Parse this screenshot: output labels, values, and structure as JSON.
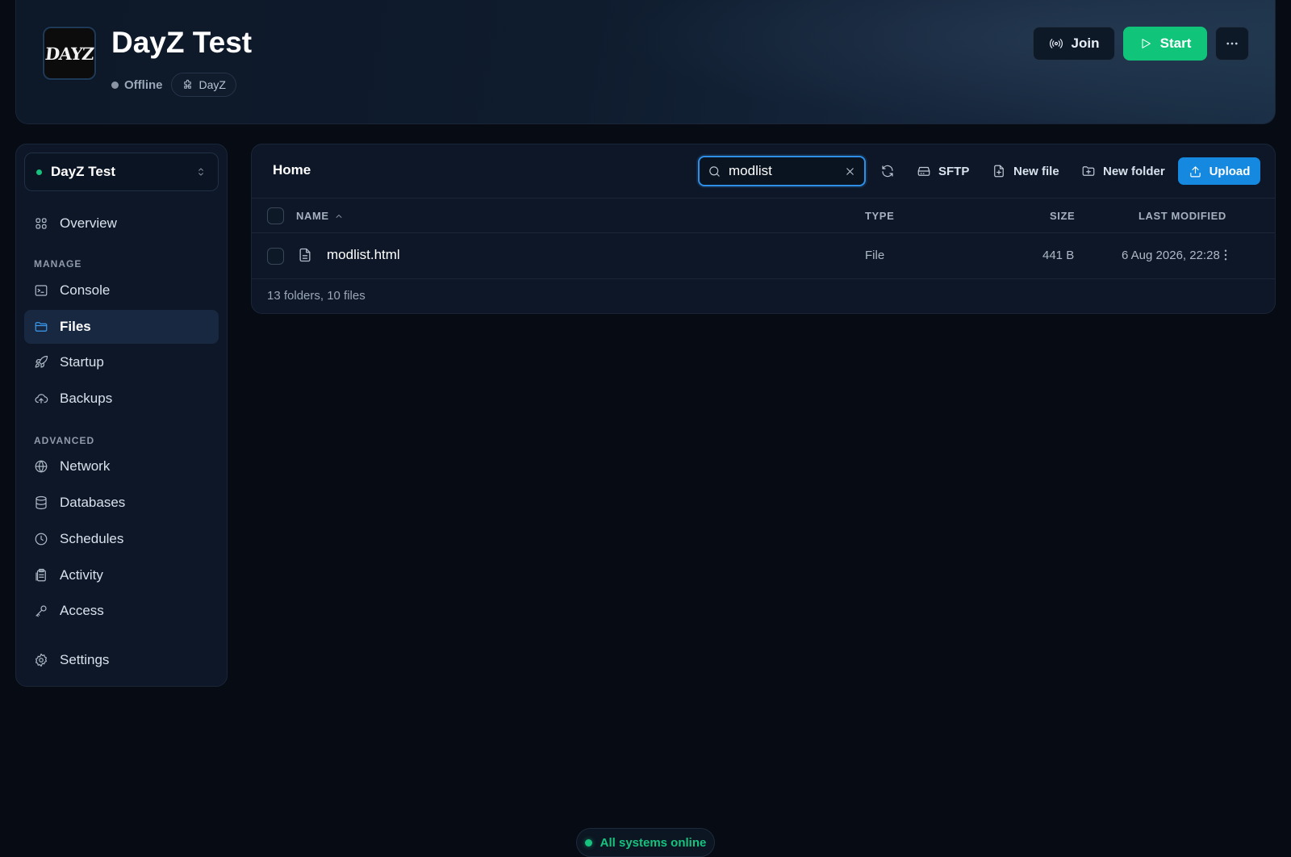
{
  "header": {
    "logo_text": "DAYZ",
    "server_name": "DayZ Test",
    "status": "Offline",
    "game": "DayZ",
    "join_label": "Join",
    "start_label": "Start"
  },
  "sidebar": {
    "selected_server": "DayZ Test",
    "overview": "Overview",
    "section_manage": "MANAGE",
    "manage_items": [
      {
        "label": "Console"
      },
      {
        "label": "Files"
      },
      {
        "label": "Startup"
      },
      {
        "label": "Backups"
      }
    ],
    "section_advanced": "ADVANCED",
    "advanced_items": [
      {
        "label": "Network"
      },
      {
        "label": "Databases"
      },
      {
        "label": "Schedules"
      },
      {
        "label": "Activity"
      },
      {
        "label": "Access"
      }
    ],
    "settings": "Settings",
    "active_item": "Files"
  },
  "files": {
    "breadcrumb": "Home",
    "search_value": "modlist",
    "toolbar": {
      "sftp": "SFTP",
      "new_file": "New file",
      "new_folder": "New folder",
      "upload": "Upload"
    },
    "columns": {
      "name": "NAME",
      "type": "TYPE",
      "size": "SIZE",
      "modified": "LAST MODIFIED"
    },
    "rows": [
      {
        "name": "modlist.html",
        "type": "File",
        "size": "441 B",
        "modified": "6 Aug 2026, 22:28"
      }
    ],
    "summary": "13 folders, 10 files"
  },
  "footer": {
    "system_status": "All systems online"
  },
  "colors": {
    "accent": "#1589e0",
    "start": "#10c47a",
    "online": "#17c27e",
    "background": "#060b14"
  }
}
